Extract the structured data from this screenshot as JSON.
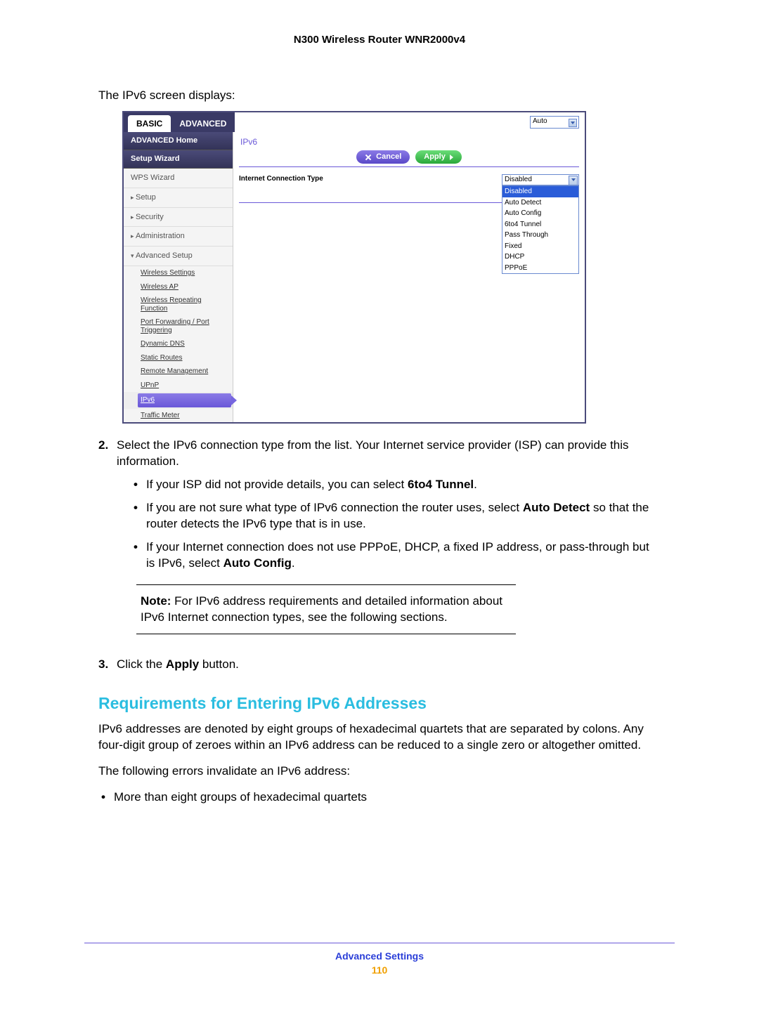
{
  "header": {
    "model": "N300 Wireless Router WNR2000v4"
  },
  "intro": "The IPv6 screen displays:",
  "router": {
    "tabs": {
      "basic": "BASIC",
      "advanced": "ADVANCED"
    },
    "auto_value": "Auto",
    "sidebar": {
      "adv_home": "ADVANCED Home",
      "setup_wizard": "Setup Wizard",
      "wps_wizard": "WPS Wizard",
      "setup": "Setup",
      "security": "Security",
      "administration": "Administration",
      "advanced_setup": "Advanced Setup",
      "subs": {
        "wireless_settings": "Wireless Settings",
        "wireless_ap": "Wireless AP",
        "wireless_repeating": "Wireless Repeating Function",
        "port_fwd": "Port Forwarding / Port Triggering",
        "dynamic_dns": "Dynamic DNS",
        "static_routes": "Static Routes",
        "remote_mgmt": "Remote Management",
        "upnp": "UPnP",
        "ipv6": "IPv6",
        "traffic_meter": "Traffic Meter"
      }
    },
    "pane": {
      "title": "IPv6",
      "cancel": "Cancel",
      "apply": "Apply",
      "conn_label": "Internet Connection Type",
      "conn_value": "Disabled",
      "dropdown": [
        "Disabled",
        "Auto Detect",
        "Auto Config",
        "6to4 Tunnel",
        "Pass Through",
        "Fixed",
        "DHCP",
        "PPPoE"
      ]
    }
  },
  "step2": {
    "num": "2.",
    "text_a": "Select the IPv6 connection type from the list. Your Internet service provider (ISP) can provide this information.",
    "b1_a": "If your ISP did not provide details, you can select ",
    "b1_bold": "6to4 Tunnel",
    "b1_b": ".",
    "b2_a": "If you are not sure what type of IPv6 connection the router uses, select ",
    "b2_bold": "Auto Detect",
    "b2_b": " so that the router detects the IPv6 type that is in use.",
    "b3_a": "If your Internet connection does not use PPPoE, DHCP, a fixed IP address, or pass-through but is IPv6, select ",
    "b3_bold": "Auto Config",
    "b3_b": "."
  },
  "note": {
    "label": "Note:",
    "text": " For IPv6 address requirements and detailed information about IPv6 Internet connection types, see the following sections."
  },
  "step3": {
    "num": "3.",
    "text_a": "Click the ",
    "bold": "Apply",
    "text_b": " button."
  },
  "section_title": "Requirements for Entering IPv6 Addresses",
  "para1": "IPv6 addresses are denoted by eight groups of hexadecimal quartets that are separated by colons. Any four-digit group of zeroes within an IPv6 address can be reduced to a single zero or altogether omitted.",
  "para2": "The following errors invalidate an IPv6 address:",
  "err_bullet": "More than eight groups of hexadecimal quartets",
  "footer": {
    "section": "Advanced Settings",
    "page": "110"
  }
}
